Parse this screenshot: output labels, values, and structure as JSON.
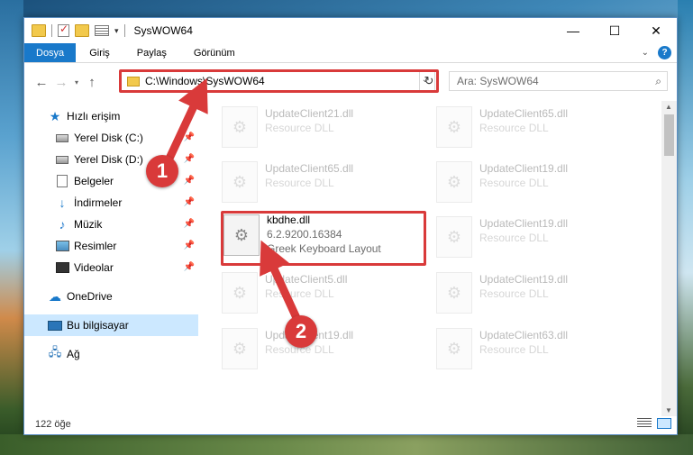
{
  "window": {
    "title": "SysWOW64"
  },
  "ribbon": {
    "tabs": [
      "Dosya",
      "Giriş",
      "Paylaş",
      "Görünüm"
    ]
  },
  "address": {
    "path": "C:\\Windows\\SysWOW64"
  },
  "search": {
    "placeholder": "Ara: SysWOW64"
  },
  "nav": {
    "quick_access": "Hızlı erişim",
    "items": [
      "Yerel Disk (C:)",
      "Yerel Disk (D:)",
      "Belgeler",
      "İndirmeler",
      "Müzik",
      "Resimler",
      "Videolar"
    ],
    "onedrive": "OneDrive",
    "this_pc": "Bu bilgisayar",
    "network": "Ağ"
  },
  "files": [
    {
      "name": "UpdateClient21.dll",
      "sub": "Resource DLL"
    },
    {
      "name": "UpdateClient65.dll",
      "sub": "Resource DLL"
    },
    {
      "name": "UpdateClient65.dll",
      "sub": "Resource DLL"
    },
    {
      "name": "UpdateClient19.dll",
      "sub": "Resource DLL"
    },
    {
      "name": "kbdhe.dll",
      "sub": "6.2.9200.16384",
      "desc": "Greek Keyboard Layout"
    },
    {
      "name": "UpdateClient19.dll",
      "sub": "Resource DLL"
    },
    {
      "name": "UpdateClient5.dll",
      "sub": "Resource DLL"
    },
    {
      "name": "UpdateClient19.dll",
      "sub": "Resource DLL"
    },
    {
      "name": "UpdateClient19.dll",
      "sub": "Resource DLL"
    },
    {
      "name": "UpdateClient63.dll",
      "sub": "Resource DLL"
    }
  ],
  "status": {
    "count": "122 öğe"
  },
  "badges": {
    "one": "1",
    "two": "2"
  },
  "colors": {
    "accent": "#1979ca",
    "highlight": "#d93a3a",
    "selected": "#cce8ff"
  }
}
